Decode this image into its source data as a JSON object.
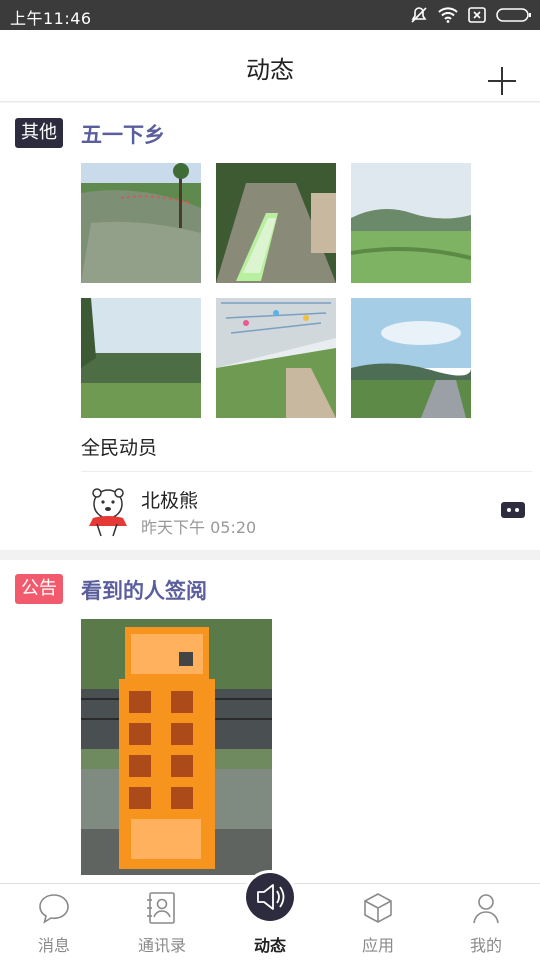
{
  "status_bar": {
    "time": "上午11:46"
  },
  "header": {
    "title": "动态"
  },
  "posts": [
    {
      "tag": "其他",
      "tag_color": "#2c2c3e",
      "title": "五一下乡",
      "caption": "全民动员",
      "author": "北极熊",
      "time": "昨天下午 05:20"
    },
    {
      "tag": "公告",
      "tag_color": "#f25b6e",
      "title": "看到的人签阅"
    }
  ],
  "tabbar": {
    "tabs": [
      {
        "label": "消息",
        "icon": "message-icon"
      },
      {
        "label": "通讯录",
        "icon": "contacts-icon"
      },
      {
        "label": "动态",
        "icon": "speaker-icon"
      },
      {
        "label": "应用",
        "icon": "cube-icon"
      },
      {
        "label": "我的",
        "icon": "person-icon"
      }
    ],
    "active": "动态"
  },
  "colors": {
    "title": "#5b5e9c",
    "dark": "#2c2c3e",
    "notice": "#f25b6e"
  }
}
